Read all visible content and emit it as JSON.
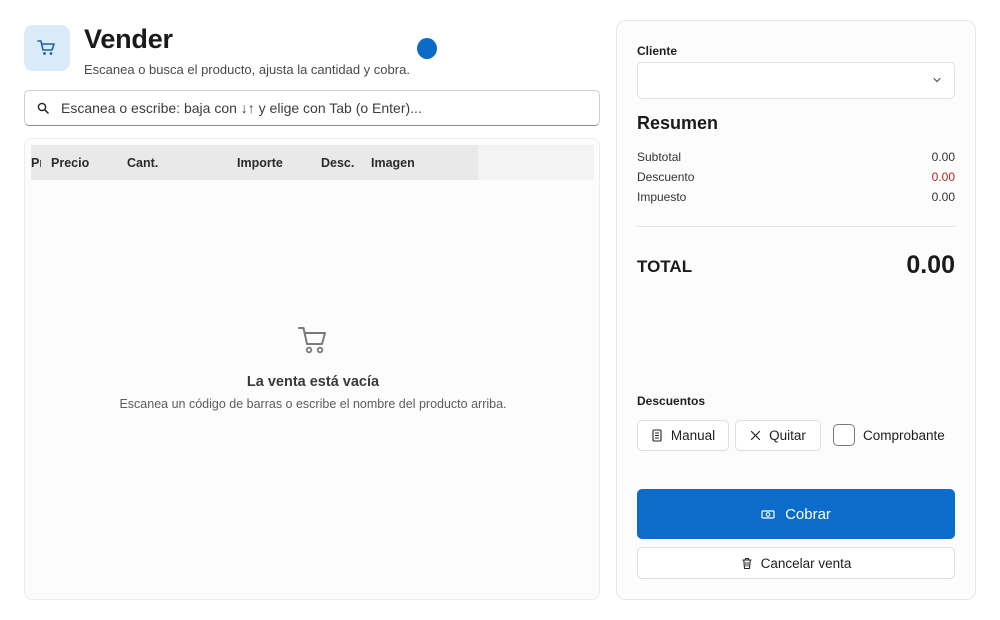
{
  "header": {
    "title": "Vender",
    "subtitle": "Escanea o busca el producto, ajusta la cantidad y cobra.",
    "icon": "shopping-cart-icon",
    "accent_color": "#0c6ccc"
  },
  "search": {
    "placeholder": "Escanea o escribe: baja con ↓↑ y elige con Tab (o Enter)...",
    "value": "",
    "icon": "search-icon"
  },
  "grid": {
    "columns": [
      "Pr",
      "Precio",
      "Cant.",
      "Importe",
      "Desc.",
      "Imagen"
    ],
    "rows": [],
    "empty_title": "La venta está vacía",
    "empty_subtitle": "Escanea un código de barras o escribe el nombre del producto arriba.",
    "empty_icon": "shopping-cart-icon"
  },
  "side": {
    "cliente_label": "Cliente",
    "cliente_value": "",
    "resumen_title": "Resumen",
    "summary": [
      {
        "label": "Subtotal",
        "value": "0.00"
      },
      {
        "label": "Descuento",
        "value": "0.00"
      },
      {
        "label": "Impuesto",
        "value": "0.00"
      }
    ],
    "discount_color": "#b3261e",
    "total_label": "TOTAL",
    "total_value": "0.00",
    "descuentos_label": "Descuentos",
    "manual_label": "Manual",
    "quitar_label": "Quitar",
    "comprobante_label": "Comprobante",
    "comprobante_checked": false,
    "cobrar_label": "Cobrar",
    "cancel_label": "Cancelar venta"
  }
}
